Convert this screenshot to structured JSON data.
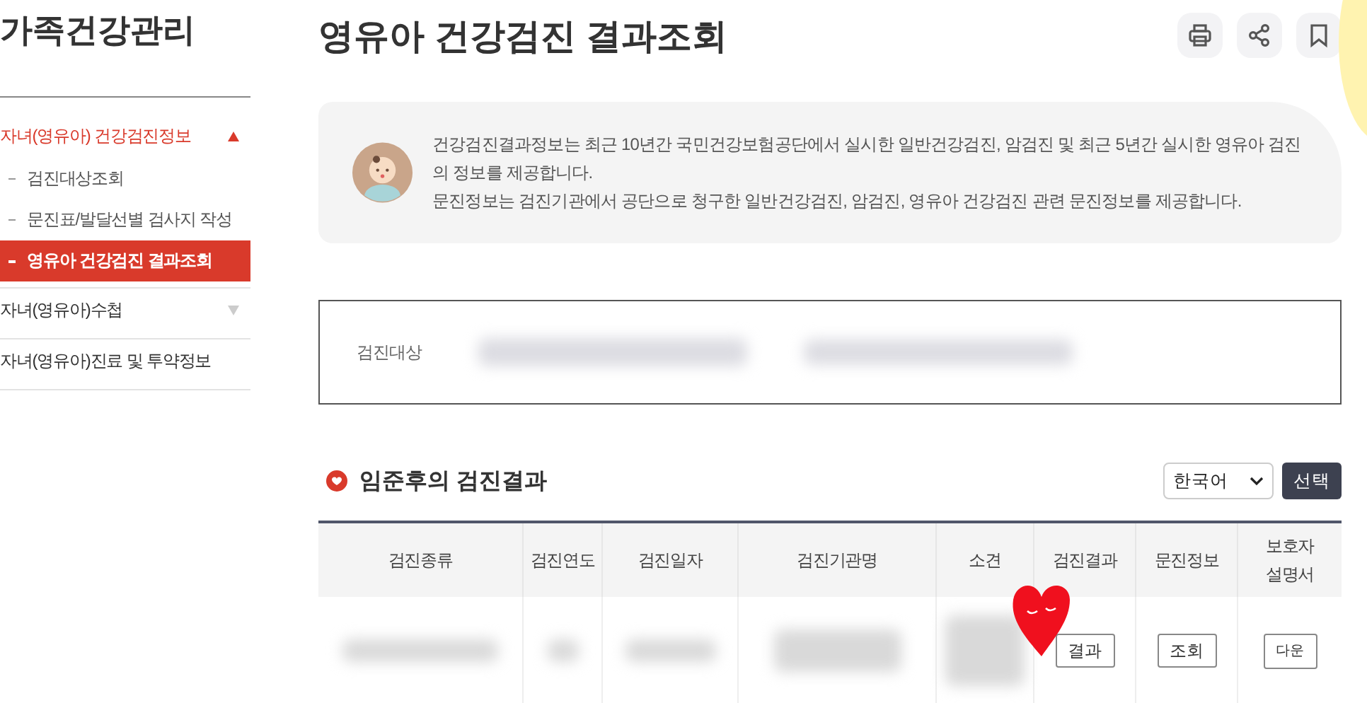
{
  "sidebar": {
    "title": "가족건강관리",
    "items": [
      {
        "label": "자녀(영유아) 건강검진정보",
        "expanded": true,
        "children": [
          {
            "label": "검진대상조회",
            "selected": false
          },
          {
            "label": "문진표/발달선별 검사지 작성",
            "selected": false
          },
          {
            "label": "영유아 건강검진 결과조회",
            "selected": true
          }
        ]
      },
      {
        "label": "자녀(영유아)수첩",
        "expanded": false
      },
      {
        "label": "자녀(영유아)진료 및 투약정보"
      }
    ]
  },
  "page": {
    "title": "영유아 건강검진 결과조회"
  },
  "info": {
    "paragraphs": [
      "건강검진결과정보는 최근 10년간 국민건강보험공단에서 실시한 일반건강검진, 암검진 및 최근 5년간 실시한 영유아 검진의 정보를 제공합니다.",
      "문진정보는 검진기관에서 공단으로 청구한 일반건강검진, 암검진, 영유아 건강검진 관련 문진정보를 제공합니다."
    ]
  },
  "target": {
    "label": "검진대상"
  },
  "results": {
    "title": "임준후의 검진결과",
    "language": "한국어",
    "select_button": "선택",
    "columns": [
      "검진종류",
      "검진연도",
      "검진일자",
      "검진기관명",
      "소견",
      "검진결과",
      "문진정보",
      "보호자 설명서"
    ],
    "rows": [
      {
        "buttons": [
          "결과",
          "조회",
          "다운"
        ]
      }
    ]
  }
}
